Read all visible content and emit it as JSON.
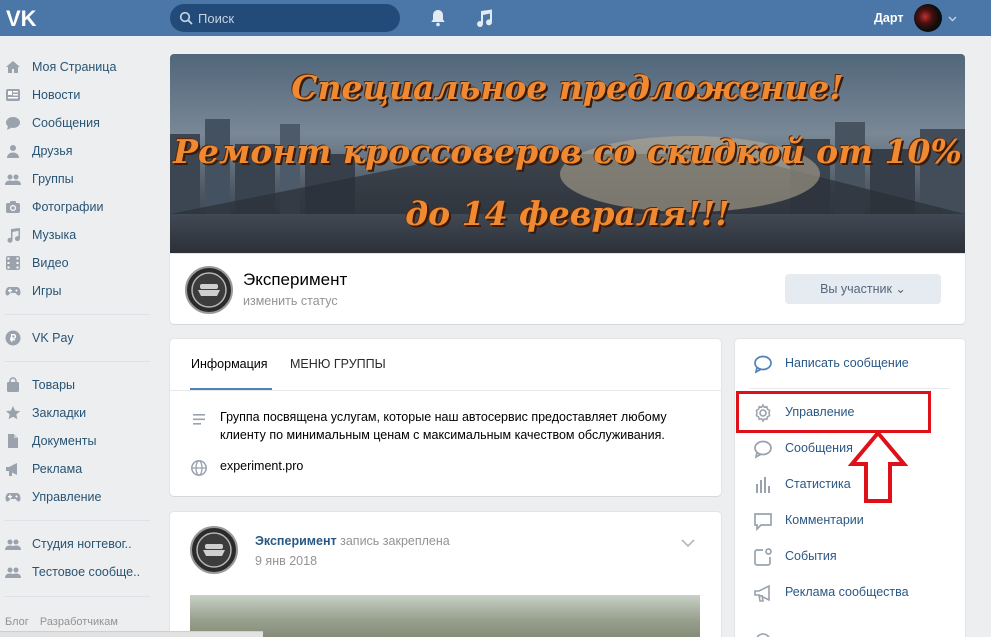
{
  "topbar": {
    "search_placeholder": "Поиск",
    "user_name": "Дарт",
    "icons": [
      "vk-logo-icon",
      "search-icon",
      "bell-icon",
      "music-icon",
      "chevron-down-icon"
    ]
  },
  "sidebar": {
    "items": [
      {
        "label": "Моя Страница",
        "icon": "home-icon"
      },
      {
        "label": "Новости",
        "icon": "news-icon"
      },
      {
        "label": "Сообщения",
        "icon": "messages-icon"
      },
      {
        "label": "Друзья",
        "icon": "friends-icon"
      },
      {
        "label": "Группы",
        "icon": "groups-icon"
      },
      {
        "label": "Фотографии",
        "icon": "camera-icon"
      },
      {
        "label": "Музыка",
        "icon": "music-icon"
      },
      {
        "label": "Видео",
        "icon": "video-icon"
      },
      {
        "label": "Игры",
        "icon": "gamepad-icon"
      },
      {
        "label": "VK Pay",
        "icon": "vkpay-icon"
      },
      {
        "label": "Товары",
        "icon": "bag-icon"
      },
      {
        "label": "Закладки",
        "icon": "star-icon"
      },
      {
        "label": "Документы",
        "icon": "document-icon"
      },
      {
        "label": "Реклама",
        "icon": "megaphone-icon"
      },
      {
        "label": "Управление",
        "icon": "gamepad-icon"
      },
      {
        "label": "Студия ногтевог..",
        "icon": "community-icon"
      },
      {
        "label": "Тестовое сообще..",
        "icon": "community-icon"
      }
    ],
    "footer": [
      "Блог",
      "Разработчикам"
    ]
  },
  "cover": {
    "lines": [
      "Специальное предложение!",
      "Ремонт кроссоверов со скидкой от 10%",
      "до 14 февраля!!!"
    ]
  },
  "group": {
    "name": "Эксперимент",
    "status": "изменить статус",
    "member_button": "Вы участник"
  },
  "info": {
    "tabs": [
      "Информация",
      "МЕНЮ ГРУППЫ"
    ],
    "description_line1": "Группа посвящена услугам, которые наш автосервис предоставляет любому",
    "description_line2": "клиенту по минимальным ценам с максимальным качеством обслуживания.",
    "site": "experiment.pro"
  },
  "post": {
    "author": "Эксперимент",
    "pinned": "запись закреплена",
    "date": "9 янв 2018"
  },
  "actions": {
    "write_message": "Написать сообщение",
    "items": [
      {
        "label": "Управление",
        "icon": "gear-icon"
      },
      {
        "label": "Сообщения",
        "icon": "message-bubble-icon"
      },
      {
        "label": "Статистика",
        "icon": "stats-icon"
      },
      {
        "label": "Комментарии",
        "icon": "comment-icon"
      },
      {
        "label": "События",
        "icon": "events-icon"
      },
      {
        "label": "Реклама сообщества",
        "icon": "megaphone-icon"
      }
    ]
  },
  "colors": {
    "header": "#4a76a8",
    "link": "#2a5885",
    "highlight": "#e0101a",
    "cover_text": "#f08a32"
  }
}
